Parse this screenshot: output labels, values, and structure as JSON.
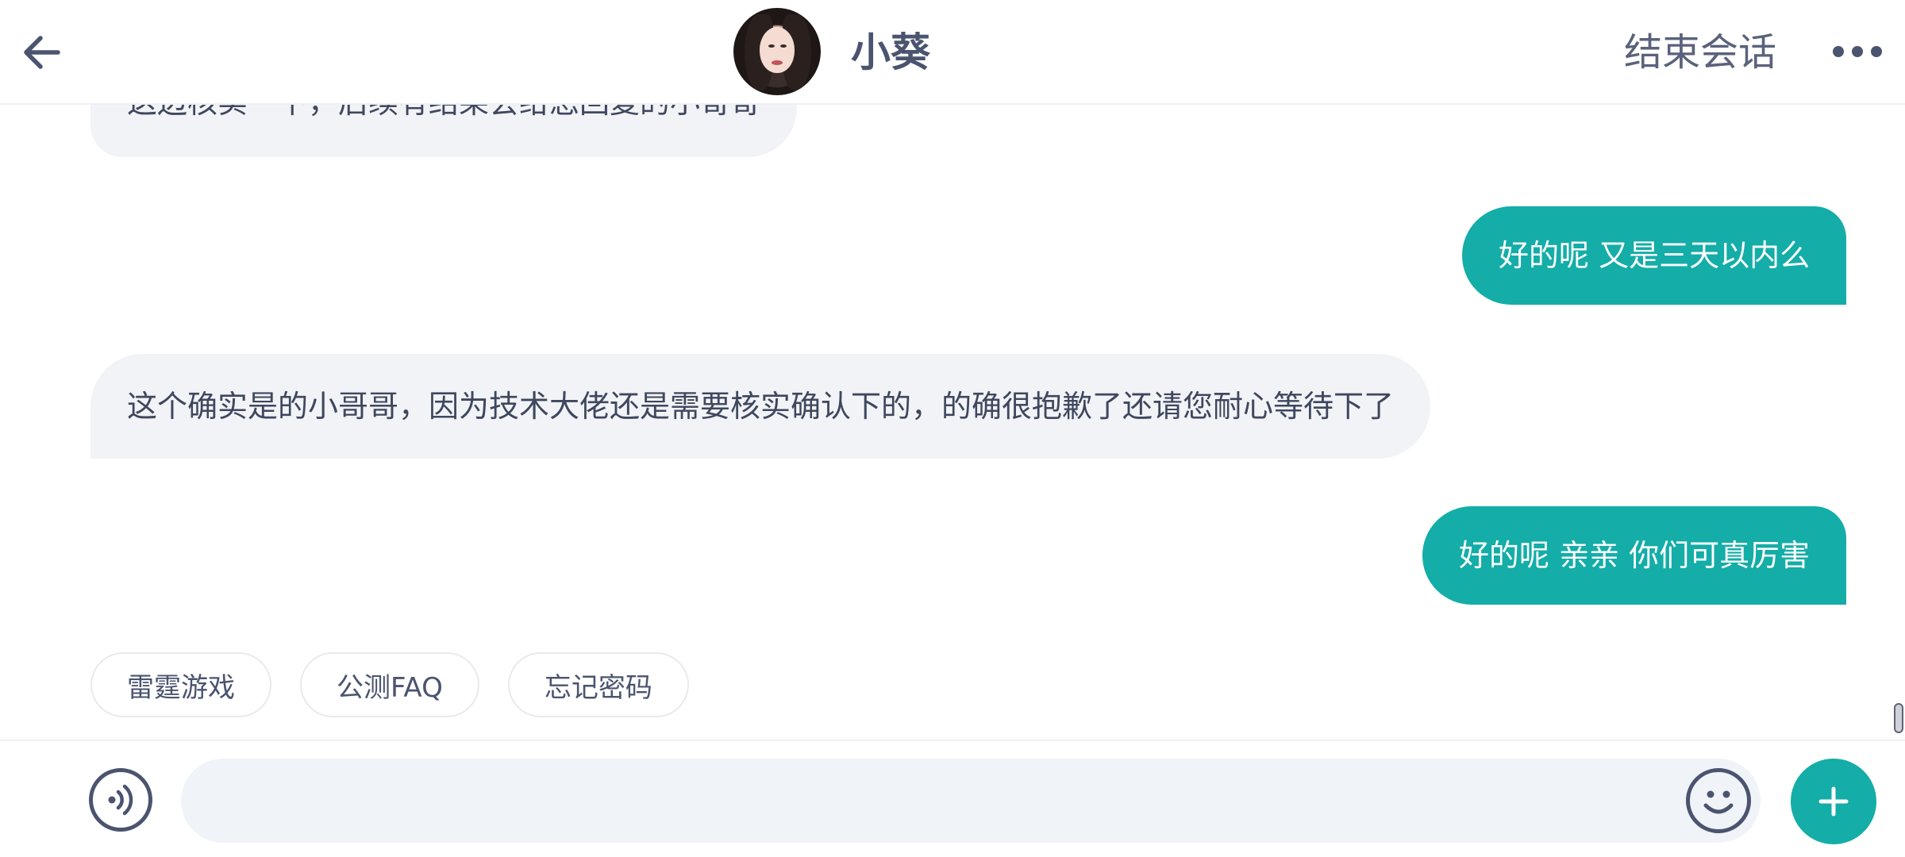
{
  "header": {
    "back_icon": "arrow-left-icon",
    "agent_name": "小葵",
    "end_session_label": "结束会话",
    "more_icon": "more-horizontal-icon"
  },
  "messages": [
    {
      "side": "left",
      "text": "这边核实一下，后续有结果会给您回复的小哥哥"
    },
    {
      "side": "right",
      "text": "好的呢 又是三天以内么"
    },
    {
      "side": "left",
      "text": "这个确实是的小哥哥，因为技术大佬还是需要核实确认下的，的确很抱歉了还请您耐心等待下了"
    },
    {
      "side": "right",
      "text": "好的呢 亲亲 你们可真厉害"
    }
  ],
  "quick_replies": [
    "雷霆游戏",
    "公测FAQ",
    "忘记密码"
  ],
  "input": {
    "value": "",
    "placeholder": ""
  },
  "colors": {
    "accent": "#14ada8",
    "text_primary": "#4b546f",
    "bubble_left_bg": "#f1f3f6",
    "input_bg": "#f0f3f7"
  }
}
